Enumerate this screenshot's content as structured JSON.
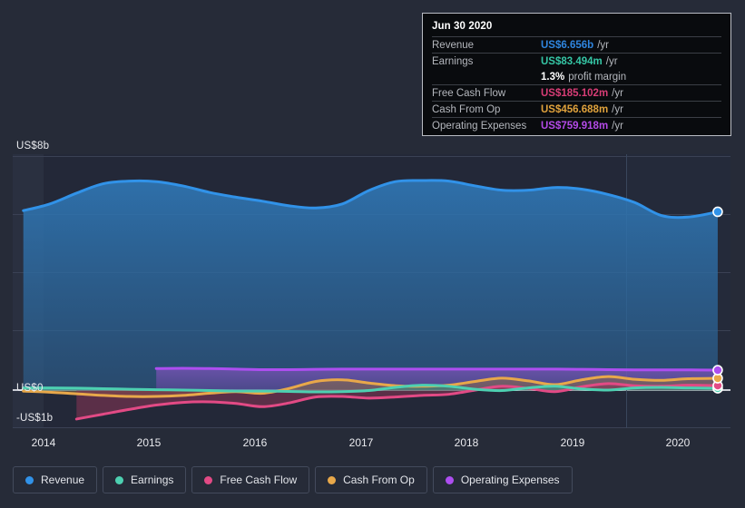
{
  "tooltip": {
    "date": "Jun 30 2020",
    "rows": [
      {
        "label": "Revenue",
        "value": "US$6.656b",
        "unit": "/yr",
        "color": "#2f86e0"
      },
      {
        "label": "Earnings",
        "value": "US$83.494m",
        "unit": "/yr",
        "color": "#35c6a5"
      },
      {
        "label": "Free Cash Flow",
        "value": "US$185.102m",
        "unit": "/yr",
        "color": "#d83d76"
      },
      {
        "label": "Cash From Op",
        "value": "US$456.688m",
        "unit": "/yr",
        "color": "#e0a23c"
      },
      {
        "label": "Operating Expenses",
        "value": "US$759.918m",
        "unit": "/yr",
        "color": "#b44ae8"
      }
    ],
    "profit_margin_value": "1.3%",
    "profit_margin_label": "profit margin"
  },
  "legend": [
    {
      "label": "Revenue",
      "color": "#3192e8"
    },
    {
      "label": "Earnings",
      "color": "#4dd0b1"
    },
    {
      "label": "Free Cash Flow",
      "color": "#e24a85"
    },
    {
      "label": "Cash From Op",
      "color": "#e8a84a"
    },
    {
      "label": "Operating Expenses",
      "color": "#ad4ef0"
    }
  ],
  "axes": {
    "y_labels": [
      "US$8b",
      "US$0",
      "-US$1b"
    ],
    "x_labels": [
      "2014",
      "2015",
      "2016",
      "2017",
      "2018",
      "2019",
      "2020"
    ]
  },
  "chart_data": {
    "type": "area",
    "title": "",
    "xlabel": "",
    "ylabel": "",
    "ylim": [
      -1.4,
      8.8
    ],
    "y_ticks": [
      8,
      0,
      -1
    ],
    "y_tick_labels": [
      "US$8b",
      "US$0",
      "-US$1b"
    ],
    "x": [
      "2014",
      "2015",
      "2016",
      "2017",
      "2018",
      "2019",
      "2020"
    ],
    "xlim": [
      "2013.85",
      "2020.60"
    ],
    "grid": true,
    "legend_position": "bottom",
    "units": "billions of USD per year (trailing twelve months)",
    "forecast_divider_x": "2019.55",
    "series": [
      {
        "name": "Revenue",
        "color": "#3192e8",
        "filled": true,
        "x": [
          2013.95,
          2014.2,
          2014.45,
          2014.7,
          2014.95,
          2015.2,
          2015.45,
          2015.7,
          2015.95,
          2016.2,
          2016.45,
          2016.7,
          2016.95,
          2017.2,
          2017.45,
          2017.7,
          2017.95,
          2018.2,
          2018.45,
          2018.7,
          2018.95,
          2019.2,
          2019.45,
          2019.7,
          2019.95,
          2020.2,
          2020.48
        ],
        "values": [
          6.7,
          6.95,
          7.35,
          7.7,
          7.8,
          7.78,
          7.62,
          7.38,
          7.2,
          7.05,
          6.88,
          6.8,
          6.95,
          7.45,
          7.78,
          7.82,
          7.8,
          7.62,
          7.46,
          7.46,
          7.56,
          7.5,
          7.3,
          7.0,
          6.52,
          6.46,
          6.656
        ]
      },
      {
        "name": "Earnings",
        "color": "#4dd0b1",
        "filled": true,
        "x": [
          2013.95,
          2014.2,
          2014.45,
          2014.7,
          2014.95,
          2015.2,
          2015.45,
          2015.7,
          2015.95,
          2016.2,
          2016.45,
          2016.7,
          2016.95,
          2017.2,
          2017.45,
          2017.7,
          2017.95,
          2018.2,
          2018.45,
          2018.7,
          2018.95,
          2019.2,
          2019.45,
          2019.7,
          2019.95,
          2020.2,
          2020.48
        ],
        "values": [
          0.1,
          0.1,
          0.09,
          0.07,
          0.05,
          0.03,
          0.02,
          0.0,
          -0.02,
          -0.02,
          -0.03,
          -0.05,
          -0.04,
          0.0,
          0.12,
          0.2,
          0.16,
          0.05,
          0.0,
          0.1,
          0.16,
          0.06,
          0.02,
          0.1,
          0.12,
          0.1,
          0.083494
        ]
      },
      {
        "name": "Free Cash Flow",
        "color": "#e24a85",
        "filled": true,
        "x": [
          2014.45,
          2014.7,
          2014.95,
          2015.2,
          2015.45,
          2015.7,
          2015.95,
          2016.2,
          2016.45,
          2016.7,
          2016.95,
          2017.2,
          2017.45,
          2017.7,
          2017.95,
          2018.2,
          2018.45,
          2018.7,
          2018.95,
          2019.2,
          2019.45,
          2019.7,
          2019.95,
          2020.2,
          2020.48
        ],
        "values": [
          -1.06,
          -0.88,
          -0.7,
          -0.54,
          -0.44,
          -0.42,
          -0.48,
          -0.6,
          -0.46,
          -0.24,
          -0.22,
          -0.28,
          -0.24,
          -0.18,
          -0.14,
          0.02,
          0.16,
          0.08,
          -0.04,
          0.14,
          0.26,
          0.18,
          0.16,
          0.2,
          0.185102
        ]
      },
      {
        "name": "Cash From Op",
        "color": "#e8a84a",
        "filled": true,
        "x": [
          2013.95,
          2014.2,
          2014.45,
          2014.7,
          2014.95,
          2015.2,
          2015.45,
          2015.7,
          2015.95,
          2016.2,
          2016.45,
          2016.7,
          2016.95,
          2017.2,
          2017.45,
          2017.7,
          2017.95,
          2018.2,
          2018.45,
          2018.7,
          2018.95,
          2019.2,
          2019.45,
          2019.7,
          2019.95,
          2020.2,
          2020.48
        ],
        "values": [
          -0.02,
          -0.06,
          -0.12,
          -0.18,
          -0.22,
          -0.22,
          -0.18,
          -0.1,
          -0.04,
          -0.1,
          0.08,
          0.34,
          0.4,
          0.28,
          0.18,
          0.16,
          0.2,
          0.34,
          0.46,
          0.36,
          0.22,
          0.4,
          0.52,
          0.42,
          0.38,
          0.44,
          0.456688
        ]
      },
      {
        "name": "Operating Expenses",
        "color": "#ad4ef0",
        "filled": true,
        "x": [
          2015.2,
          2015.45,
          2015.7,
          2015.95,
          2016.2,
          2016.45,
          2016.7,
          2016.95,
          2017.2,
          2017.45,
          2017.7,
          2017.95,
          2018.2,
          2018.45,
          2018.7,
          2018.95,
          2019.2,
          2019.45,
          2019.7,
          2019.95,
          2020.2,
          2020.48
        ],
        "values": [
          0.82,
          0.83,
          0.82,
          0.8,
          0.78,
          0.78,
          0.79,
          0.8,
          0.8,
          0.8,
          0.8,
          0.8,
          0.8,
          0.8,
          0.8,
          0.8,
          0.79,
          0.78,
          0.77,
          0.77,
          0.77,
          0.759918
        ]
      }
    ]
  }
}
